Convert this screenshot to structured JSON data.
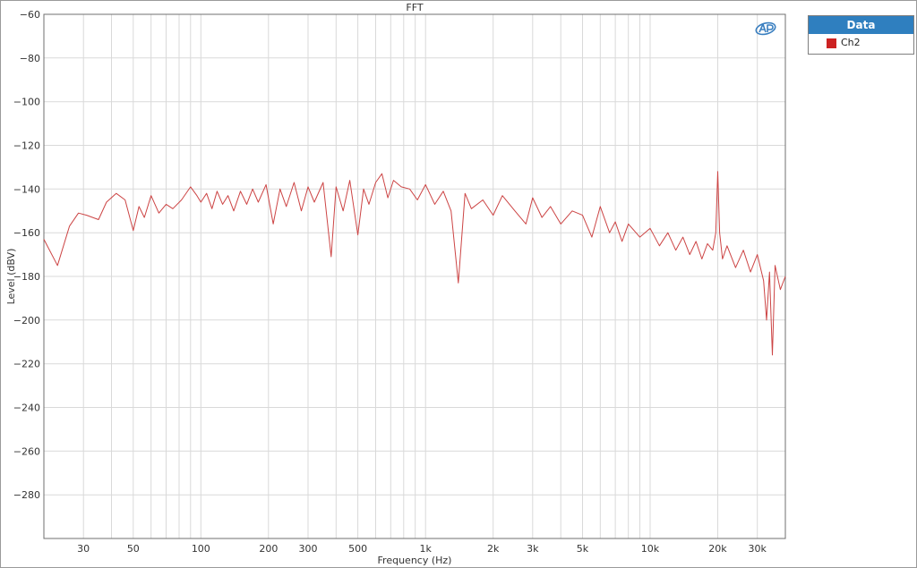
{
  "chart_data": {
    "type": "line",
    "title": "FFT",
    "xlabel": "Frequency (Hz)",
    "ylabel": "Level (dBV)",
    "xscale": "log",
    "xlim": [
      20,
      40000
    ],
    "ylim": [
      -300,
      -60
    ],
    "x_tick_labels": [
      {
        "value": 30,
        "label": "30"
      },
      {
        "value": 50,
        "label": "50"
      },
      {
        "value": 100,
        "label": "100"
      },
      {
        "value": 200,
        "label": "200"
      },
      {
        "value": 300,
        "label": "300"
      },
      {
        "value": 500,
        "label": "500"
      },
      {
        "value": 1000,
        "label": "1k"
      },
      {
        "value": 2000,
        "label": "2k"
      },
      {
        "value": 3000,
        "label": "3k"
      },
      {
        "value": 5000,
        "label": "5k"
      },
      {
        "value": 10000,
        "label": "10k"
      },
      {
        "value": 20000,
        "label": "20k"
      },
      {
        "value": 30000,
        "label": "30k"
      }
    ],
    "y_ticks": [
      -60,
      -80,
      -100,
      -120,
      -140,
      -160,
      -180,
      -200,
      -220,
      -240,
      -260,
      -280
    ],
    "grid": true,
    "legend": {
      "title": "Data",
      "placement": "top-right outside"
    },
    "series": [
      {
        "name": "Ch2",
        "color": "#cc4444",
        "x": [
          20,
          23,
          26,
          28.5,
          31,
          35,
          38,
          42,
          46,
          50,
          53,
          56,
          60,
          65,
          70,
          75,
          82,
          90,
          96,
          100,
          106,
          112,
          118,
          125,
          132,
          140,
          150,
          160,
          170,
          180,
          195,
          210,
          225,
          240,
          260,
          280,
          300,
          320,
          350,
          380,
          400,
          430,
          460,
          500,
          530,
          560,
          600,
          640,
          680,
          720,
          780,
          850,
          920,
          1000,
          1100,
          1200,
          1300,
          1400,
          1500,
          1600,
          1800,
          2000,
          2200,
          2500,
          2800,
          3000,
          3300,
          3600,
          4000,
          4500,
          5000,
          5500,
          6000,
          6600,
          7000,
          7500,
          8000,
          9000,
          10000,
          11000,
          12000,
          13000,
          14000,
          15000,
          16000,
          17000,
          18000,
          19000,
          19600,
          20000,
          20400,
          21000,
          22000,
          24000,
          26000,
          28000,
          30000,
          32000,
          33000,
          34000,
          35000,
          36000,
          38000,
          40000
        ],
        "values": [
          -163,
          -175,
          -157,
          -151,
          -152,
          -154,
          -146,
          -142,
          -145,
          -159,
          -148,
          -153,
          -143,
          -151,
          -147,
          -149,
          -145,
          -139,
          -143,
          -146,
          -142,
          -149,
          -141,
          -147,
          -143,
          -150,
          -141,
          -147,
          -140,
          -146,
          -138,
          -156,
          -140,
          -148,
          -137,
          -150,
          -139,
          -146,
          -137,
          -171,
          -139,
          -150,
          -136,
          -161,
          -140,
          -147,
          -137,
          -133,
          -144,
          -136,
          -139,
          -140,
          -145,
          -138,
          -147,
          -141,
          -150,
          -183,
          -142,
          -149,
          -145,
          -152,
          -143,
          -150,
          -156,
          -144,
          -153,
          -148,
          -156,
          -150,
          -152,
          -162,
          -148,
          -160,
          -155,
          -164,
          -156,
          -162,
          -158,
          -166,
          -160,
          -168,
          -162,
          -170,
          -164,
          -172,
          -165,
          -168,
          -160,
          -132,
          -160,
          -172,
          -166,
          -176,
          -168,
          -178,
          -170,
          -182,
          -200,
          -178,
          -216,
          -175,
          -186,
          -180
        ]
      }
    ]
  }
}
